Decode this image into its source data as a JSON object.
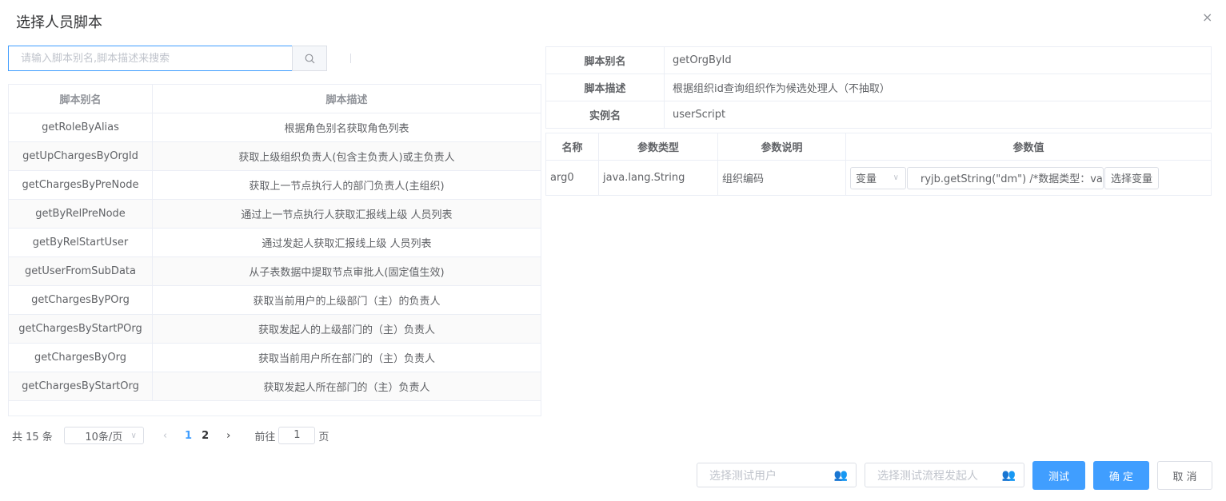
{
  "dialog": {
    "title": "选择人员脚本",
    "close": "×"
  },
  "search": {
    "placeholder": "请输入脚本别名,脚本描述来搜索"
  },
  "list": {
    "headers": [
      "脚本别名",
      "脚本描述"
    ],
    "rows": [
      [
        "getRoleByAlias",
        "根据角色别名获取角色列表"
      ],
      [
        "getUpChargesByOrgId",
        "获取上级组织负责人(包含主负责人)或主负责人"
      ],
      [
        "getChargesByPreNode",
        "获取上一节点执行人的部门负责人(主组织)"
      ],
      [
        "getByRelPreNode",
        "通过上一节点执行人获取汇报线上级 人员列表"
      ],
      [
        "getByRelStartUser",
        "通过发起人获取汇报线上级 人员列表"
      ],
      [
        "getUserFromSubData",
        "从子表数据中提取节点审批人(固定值生效)"
      ],
      [
        "getChargesByPOrg",
        "获取当前用户的上级部门（主）的负责人"
      ],
      [
        "getChargesByStartPOrg",
        "获取发起人的上级部门的（主）负责人"
      ],
      [
        "getChargesByOrg",
        "获取当前用户所在部门的（主）负责人"
      ],
      [
        "getChargesByStartOrg",
        "获取发起人所在部门的（主）负责人"
      ]
    ]
  },
  "pagination": {
    "total": "共 15 条",
    "page_size": "10条/页",
    "pages": [
      "1",
      "2"
    ],
    "current": "1",
    "goto_label": "前往",
    "goto_value": "1",
    "page_suffix": "页"
  },
  "detail": {
    "alias_label": "脚本别名",
    "alias": "getOrgById",
    "desc_label": "脚本描述",
    "desc": "根据组织id查询组织作为候选处理人（不抽取）",
    "instance_label": "实例名",
    "instance": "userScript"
  },
  "params": {
    "headers": [
      "名称",
      "参数类型",
      "参数说明",
      "参数值"
    ],
    "rows": [
      {
        "name": "arg0",
        "type": "java.lang.String",
        "desc": "组织编码",
        "mode": "变量",
        "value": "ryjb.getString(\"dm\") /*数据类型：varchar*/",
        "select_btn": "选择变量"
      }
    ]
  },
  "footer": {
    "test_user_placeholder": "选择测试用户",
    "test_starter_placeholder": "选择测试流程发起人",
    "test": "测试",
    "confirm": "确 定",
    "cancel": "取 消"
  },
  "colors": {
    "primary": "#409eff"
  }
}
